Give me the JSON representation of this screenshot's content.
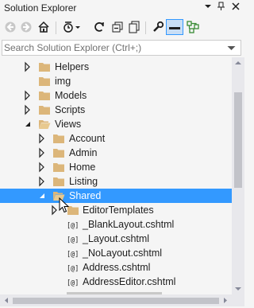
{
  "window": {
    "title": "Solution Explorer",
    "title_buttons": [
      "dropdown-icon",
      "pin-icon",
      "close-icon"
    ]
  },
  "toolbar": {
    "buttons": [
      "back-icon",
      "forward-icon",
      "home-icon",
      "pending-changes-icon",
      "dropdown-icon",
      "sync-icon",
      "collapse-all-icon",
      "show-all-files-icon",
      "properties-icon",
      "preview-icon",
      "class-view-icon"
    ]
  },
  "search": {
    "placeholder": "Search Solution Explorer (Ctrl+;)"
  },
  "tree": {
    "items": [
      {
        "label": "Helpers",
        "type": "folder",
        "level": 1,
        "expanded": false
      },
      {
        "label": "img",
        "type": "folder",
        "level": 1,
        "expanded": null
      },
      {
        "label": "Models",
        "type": "folder",
        "level": 1,
        "expanded": false
      },
      {
        "label": "Scripts",
        "type": "folder",
        "level": 1,
        "expanded": false
      },
      {
        "label": "Views",
        "type": "folder",
        "level": 1,
        "expanded": true
      },
      {
        "label": "Account",
        "type": "folder",
        "level": 2,
        "expanded": false
      },
      {
        "label": "Admin",
        "type": "folder",
        "level": 2,
        "expanded": false
      },
      {
        "label": "Home",
        "type": "folder",
        "level": 2,
        "expanded": false
      },
      {
        "label": "Listing",
        "type": "folder",
        "level": 2,
        "expanded": false
      },
      {
        "label": "Shared",
        "type": "folder-open",
        "level": 2,
        "expanded": true,
        "selected": true
      },
      {
        "label": "EditorTemplates",
        "type": "folder",
        "level": 3,
        "expanded": false
      },
      {
        "label": "_BlankLayout.cshtml",
        "type": "razor",
        "level": 3,
        "expanded": null
      },
      {
        "label": "_Layout.cshtml",
        "type": "razor",
        "level": 3,
        "expanded": null
      },
      {
        "label": "_NoLayout.cshtml",
        "type": "razor",
        "level": 3,
        "expanded": null
      },
      {
        "label": "Address.cshtml",
        "type": "razor",
        "level": 3,
        "expanded": null
      },
      {
        "label": "AddressEditor.cshtml",
        "type": "razor",
        "level": 3,
        "expanded": null
      }
    ]
  },
  "colors": {
    "selection": "#3399ff",
    "folder": "#dcb67a",
    "background": "#f5f5f5"
  }
}
